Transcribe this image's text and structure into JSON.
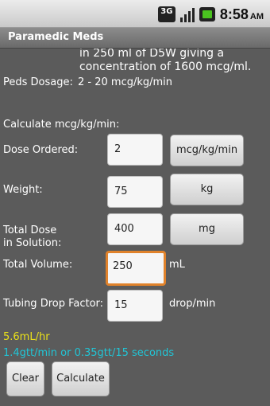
{
  "status": {
    "network": "3G",
    "time": "8:58",
    "ampm": "AM"
  },
  "app": {
    "title": "Paramedic Meds"
  },
  "info": {
    "line1": "in 250 ml of D5W giving a",
    "line2": "concentration of 1600 mcg/ml.",
    "peds_label": "Peds Dosage:",
    "peds_value": "2 - 20 mcg/kg/min"
  },
  "form": {
    "section_title": "Calculate mcg/kg/min:",
    "dose_label": "Dose Ordered:",
    "dose_value": "2",
    "dose_unit": "mcg/kg/min",
    "weight_label": "Weight:",
    "weight_value": "75",
    "weight_unit": "kg",
    "total_dose_label_1": "Total Dose",
    "total_dose_label_2": "in Solution:",
    "total_dose_value": "400",
    "total_dose_unit": "mg",
    "volume_label": "Total Volume:",
    "volume_value": "250",
    "volume_unit": "mL",
    "tubing_label": "Tubing Drop Factor:",
    "tubing_value": "15",
    "tubing_unit": "drop/min"
  },
  "results": {
    "rate": "5.6mL/hr",
    "drip": "1.4gtt/min or 0.35gtt/15 seconds"
  },
  "actions": {
    "clear": "Clear",
    "calculate": "Calculate"
  },
  "colors": {
    "result_rate": "#e9e01a",
    "result_drip": "#21c5d6",
    "focus": "#e0822b"
  }
}
